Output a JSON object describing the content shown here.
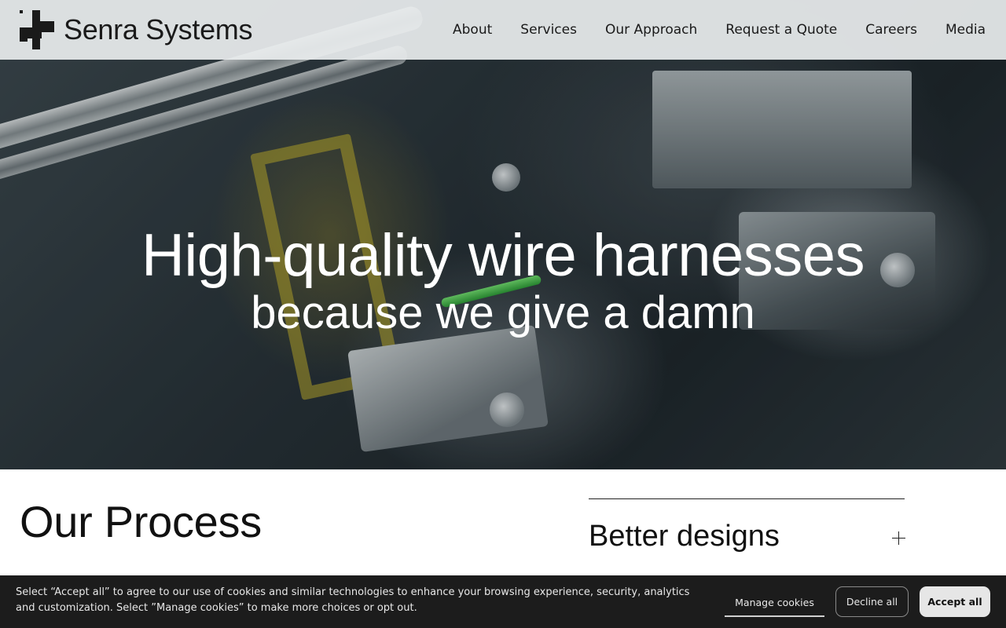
{
  "header": {
    "logo_text": "Senra Systems",
    "nav": [
      {
        "label": "About"
      },
      {
        "label": "Services"
      },
      {
        "label": "Our Approach"
      },
      {
        "label": "Request a Quote"
      },
      {
        "label": "Careers"
      },
      {
        "label": "Media"
      }
    ]
  },
  "hero": {
    "title": "High-quality wire harnesses",
    "subtitle": "because we give a damn",
    "background_image": "industrial-crimping-machine"
  },
  "process": {
    "title": "Our Process",
    "items": [
      {
        "title": "Better designs",
        "icon": "plus-icon"
      }
    ]
  },
  "cookie_banner": {
    "text": "Select “Accept all” to agree to our use of cookies and similar technologies to enhance your browsing experience, security, analytics and customization. Select ”Manage cookies” to make more choices or opt out.",
    "manage_label": "Manage cookies",
    "decline_label": "Decline all",
    "accept_label": "Accept all"
  },
  "colors": {
    "header_bg": "#e8eced",
    "cookie_bg": "#1c1c1c",
    "accept_bg": "#e6e6e6",
    "text_dark": "#111111"
  }
}
